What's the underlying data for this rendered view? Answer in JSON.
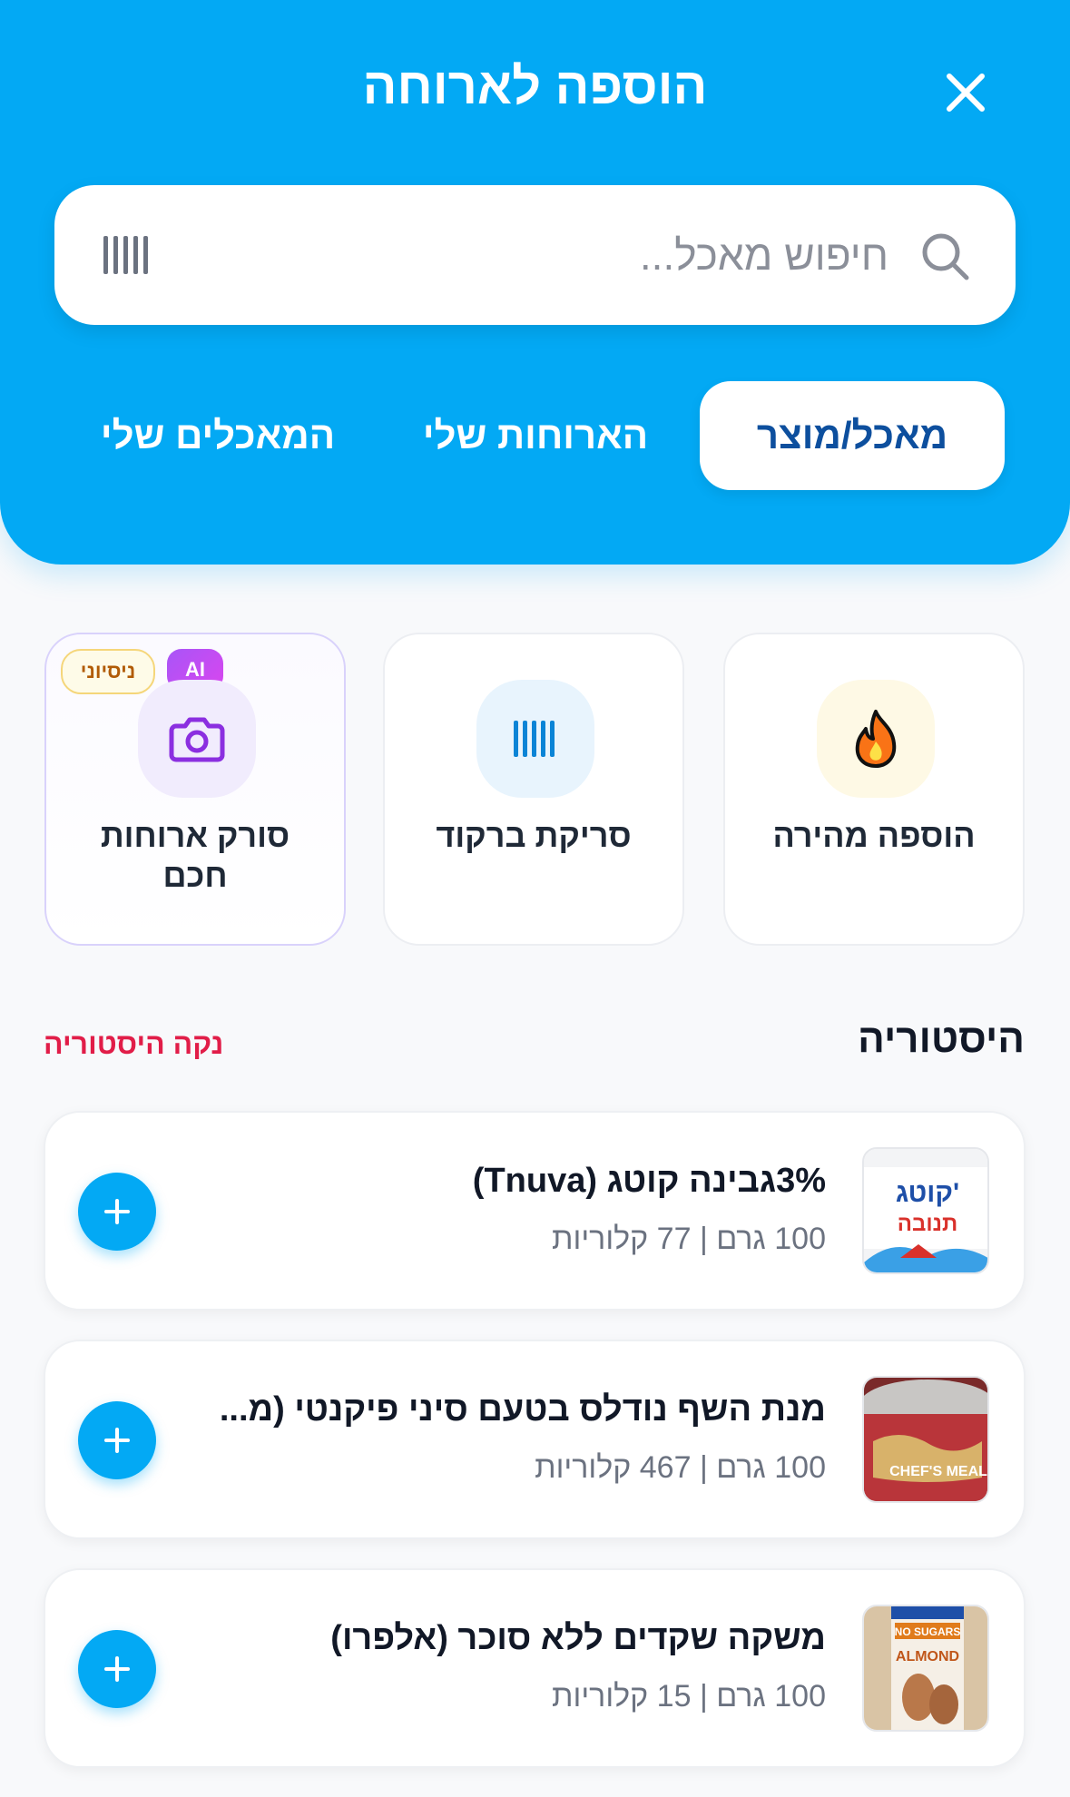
{
  "header": {
    "title": "הוספה לארוחה",
    "close_icon": "close-icon"
  },
  "search": {
    "placeholder": "חיפוש מאכל...",
    "value": "",
    "search_icon": "search-icon",
    "barcode_icon": "barcode-icon"
  },
  "tabs": [
    {
      "label": "מאכל/מוצר",
      "active": true
    },
    {
      "label": "הארוחות שלי",
      "active": false
    },
    {
      "label": "המאכלים שלי",
      "active": false
    }
  ],
  "actions": [
    {
      "label": "הוספה מהירה",
      "icon": "flame-icon"
    },
    {
      "label": "סריקת ברקוד",
      "icon": "barcode-icon"
    },
    {
      "label": "סורק ארוחות חכם",
      "icon": "camera-icon",
      "badge_ai": "AI",
      "badge_trial": "ניסיוני"
    }
  ],
  "history": {
    "title": "היסטוריה",
    "clear_label": "נקה היסטוריה",
    "items": [
      {
        "name": "3%גבינה קוטג (Tnuva)",
        "meta": "100 גרם | 77 קלוריות",
        "thumb_text_1": "קוטג'",
        "thumb_text_2": "תנובה"
      },
      {
        "name": "מנת השף נודלס בטעם סיני פיקנטי (מ...",
        "meta": "100 גרם | 467 קלוריות",
        "thumb_text_1": "CHEF'S MEAL"
      },
      {
        "name": "משקה שקדים ללא סוכר (אלפרו)",
        "meta": "100 גרם | 15 קלוריות",
        "thumb_text_1": "NO SUGARS",
        "thumb_text_2": "ALMOND"
      }
    ]
  },
  "colors": {
    "primary": "#03a9f4",
    "active_tab_text": "#0d4f9e",
    "danger": "#e11d48",
    "ai_purple": "#a855f7"
  }
}
